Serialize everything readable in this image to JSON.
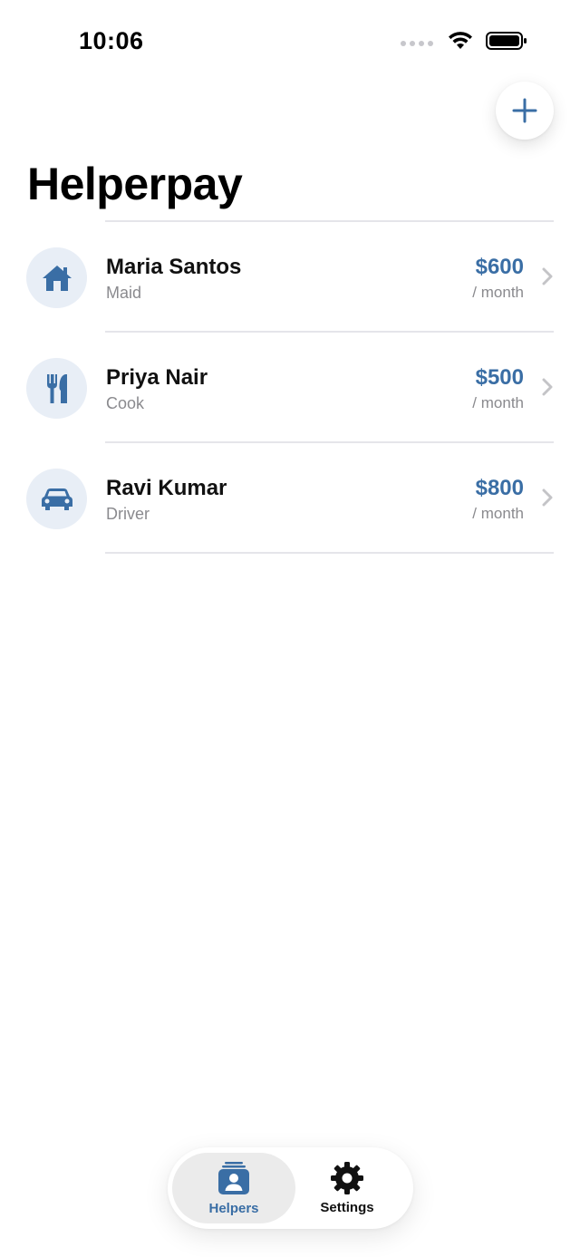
{
  "status_bar": {
    "time": "10:06"
  },
  "page": {
    "title": "Helperpay"
  },
  "helpers": [
    {
      "name": "Maria Santos",
      "role": "Maid",
      "amount": "$600",
      "period": "/ month",
      "icon": "house-icon"
    },
    {
      "name": "Priya Nair",
      "role": "Cook",
      "amount": "$500",
      "period": "/ month",
      "icon": "fork-knife-icon"
    },
    {
      "name": "Ravi Kumar",
      "role": "Driver",
      "amount": "$800",
      "period": "/ month",
      "icon": "car-icon"
    }
  ],
  "tab_bar": {
    "tabs": [
      {
        "label": "Helpers",
        "icon": "person-card-stack-icon",
        "selected": true
      },
      {
        "label": "Settings",
        "icon": "gear-icon",
        "selected": false
      }
    ]
  },
  "colors": {
    "accent": "#3a6ea5",
    "avatar_bg": "#e8eef6",
    "secondary_text": "#8a8a8e"
  }
}
